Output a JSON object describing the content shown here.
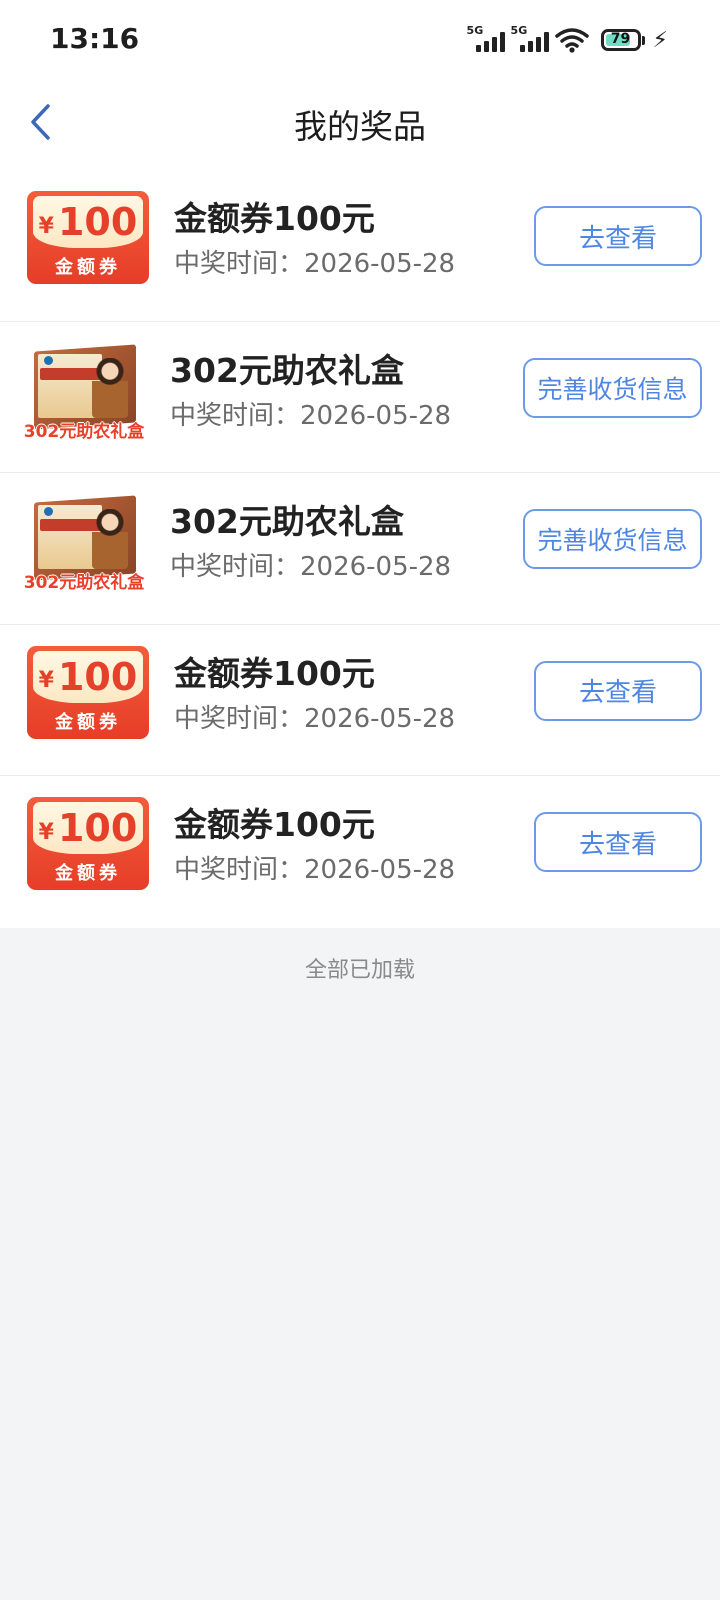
{
  "status_bar": {
    "time": "13:16",
    "network_1": "5G",
    "network_2": "5G",
    "battery_level": "79",
    "battery_fraction": 0.79,
    "icons": [
      "signal-icon",
      "wifi-icon",
      "battery-icon",
      "charging-icon"
    ]
  },
  "header": {
    "title": "我的奖品",
    "back_icon": "chevron-left-icon"
  },
  "coupon_art": {
    "yen": "¥",
    "amount": "100",
    "label": "金额券"
  },
  "box_art": {
    "caption": "302元助农礼盒"
  },
  "prizes": [
    {
      "type": "coupon",
      "name": "金额券100元",
      "time": "中奖时间：2026-05-28",
      "action": "去查看"
    },
    {
      "type": "box",
      "name": "302元助农礼盒",
      "time": "中奖时间：2026-05-28",
      "action": "完善收货信息"
    },
    {
      "type": "box",
      "name": "302元助农礼盒",
      "time": "中奖时间：2026-05-28",
      "action": "完善收货信息"
    },
    {
      "type": "coupon",
      "name": "金额券100元",
      "time": "中奖时间：2026-05-28",
      "action": "去查看"
    },
    {
      "type": "coupon",
      "name": "金额券100元",
      "time": "中奖时间：2026-05-28",
      "action": "去查看"
    }
  ],
  "footer": {
    "load_status": "全部已加载"
  },
  "colors": {
    "accent_blue": "#4f86e2",
    "coupon_red": "#e63d28",
    "background": "#f3f4f6"
  }
}
